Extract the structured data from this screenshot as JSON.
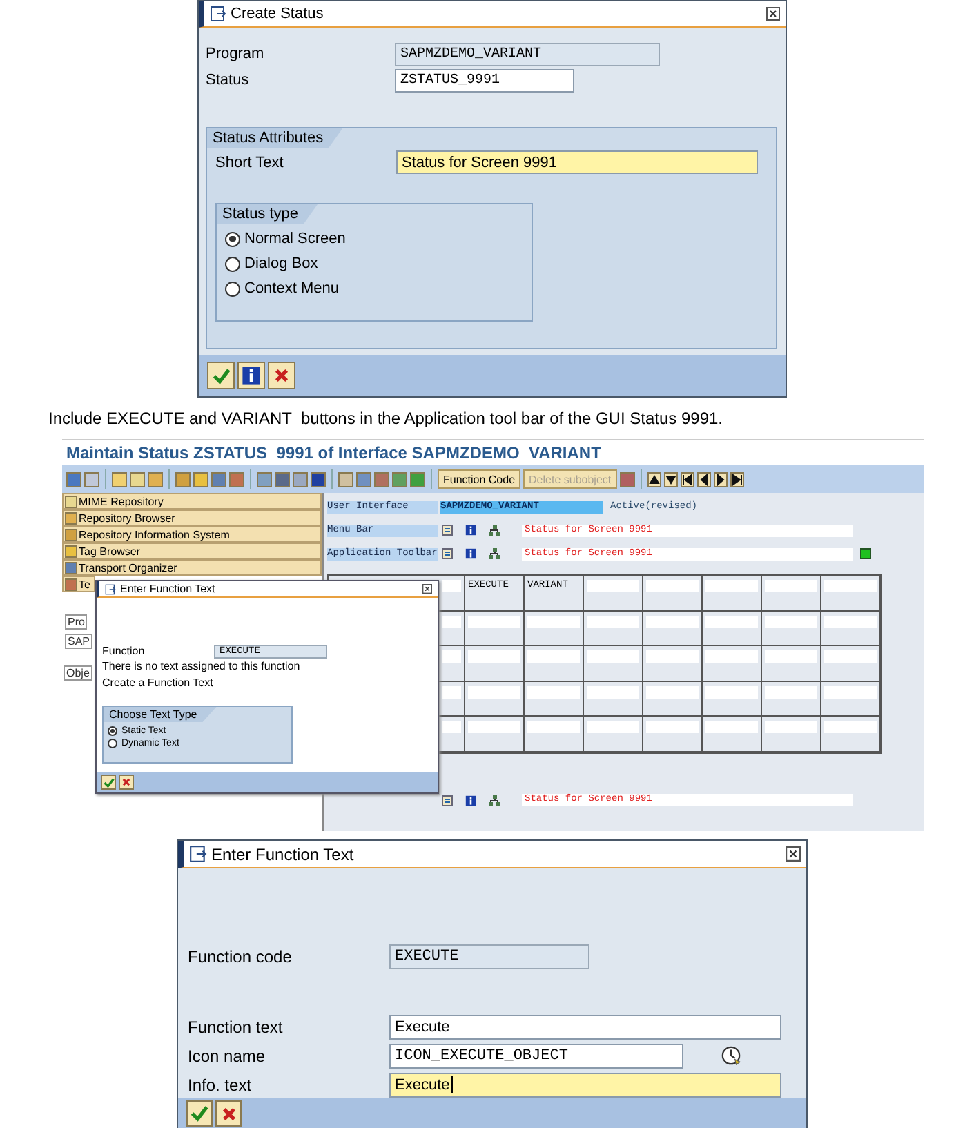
{
  "create_status": {
    "title": "Create Status",
    "fields": [
      {
        "label": "Program",
        "value": "SAPMZDEMO_VARIANT",
        "kind": "display"
      },
      {
        "label": "Status",
        "value": "ZSTATUS_9991",
        "kind": "input"
      }
    ],
    "attributes": {
      "title": "Status Attributes",
      "label": "Short Text",
      "value": "Status for Screen 9991"
    },
    "status_type": {
      "title": "Status type",
      "options": [
        {
          "label": "Normal Screen",
          "selected": true
        },
        {
          "label": "Dialog Box",
          "selected": false
        },
        {
          "label": "Context Menu",
          "selected": false
        }
      ]
    }
  },
  "caption": "Include EXECUTE and VARIANT  buttons in the Application tool bar of the GUI Status 9991.",
  "maintain": {
    "title": "Maintain Status ZSTATUS_9991 of Interface SAPMZDEMO_VARIANT",
    "toolbar_buttons": [
      {
        "label": "Function Code",
        "disabled": false
      },
      {
        "label": "Delete subobject",
        "disabled": true
      }
    ],
    "nav": [
      {
        "label": "MIME Repository"
      },
      {
        "label": "Repository Browser"
      },
      {
        "label": "Repository Information System"
      },
      {
        "label": "Tag Browser"
      },
      {
        "label": "Transport Organizer"
      },
      {
        "label": "Te"
      }
    ],
    "fragments": [
      "Pro",
      "SAP",
      "Obje"
    ],
    "interface": {
      "label": "User Interface",
      "value": "SAPMZDEMO_VARIANT",
      "status": "Active(revised)"
    },
    "rows": [
      {
        "label": "Menu Bar",
        "text": "Status for Screen 9991",
        "indicator": false
      },
      {
        "label": "Application Toolbar",
        "text": "Status for Screen 9991",
        "indicator": true
      }
    ],
    "table_first_row": [
      "EXECUTE",
      "VARIANT"
    ],
    "function_keys": {
      "text": "Status for Screen 9991"
    },
    "popup": {
      "title": "Enter Function Text",
      "label": "Function",
      "value": "EXECUTE",
      "messages": [
        "There is no text assigned to this function",
        "Create a Function Text"
      ],
      "text_type": {
        "title": "Choose Text Type",
        "options": [
          {
            "label": "Static Text",
            "selected": true
          },
          {
            "label": "Dynamic Text",
            "selected": false
          }
        ]
      }
    }
  },
  "function_text": {
    "title": "Enter Function Text",
    "fields": [
      {
        "label": "Function code",
        "value": "EXECUTE",
        "kind": "display"
      },
      {
        "label": "Function text",
        "value": "Execute",
        "kind": "input"
      },
      {
        "label": "Icon name",
        "value": "ICON_EXECUTE_OBJECT",
        "kind": "icon"
      },
      {
        "label": "Info. text",
        "value": "Execute",
        "kind": "focused"
      }
    ]
  }
}
